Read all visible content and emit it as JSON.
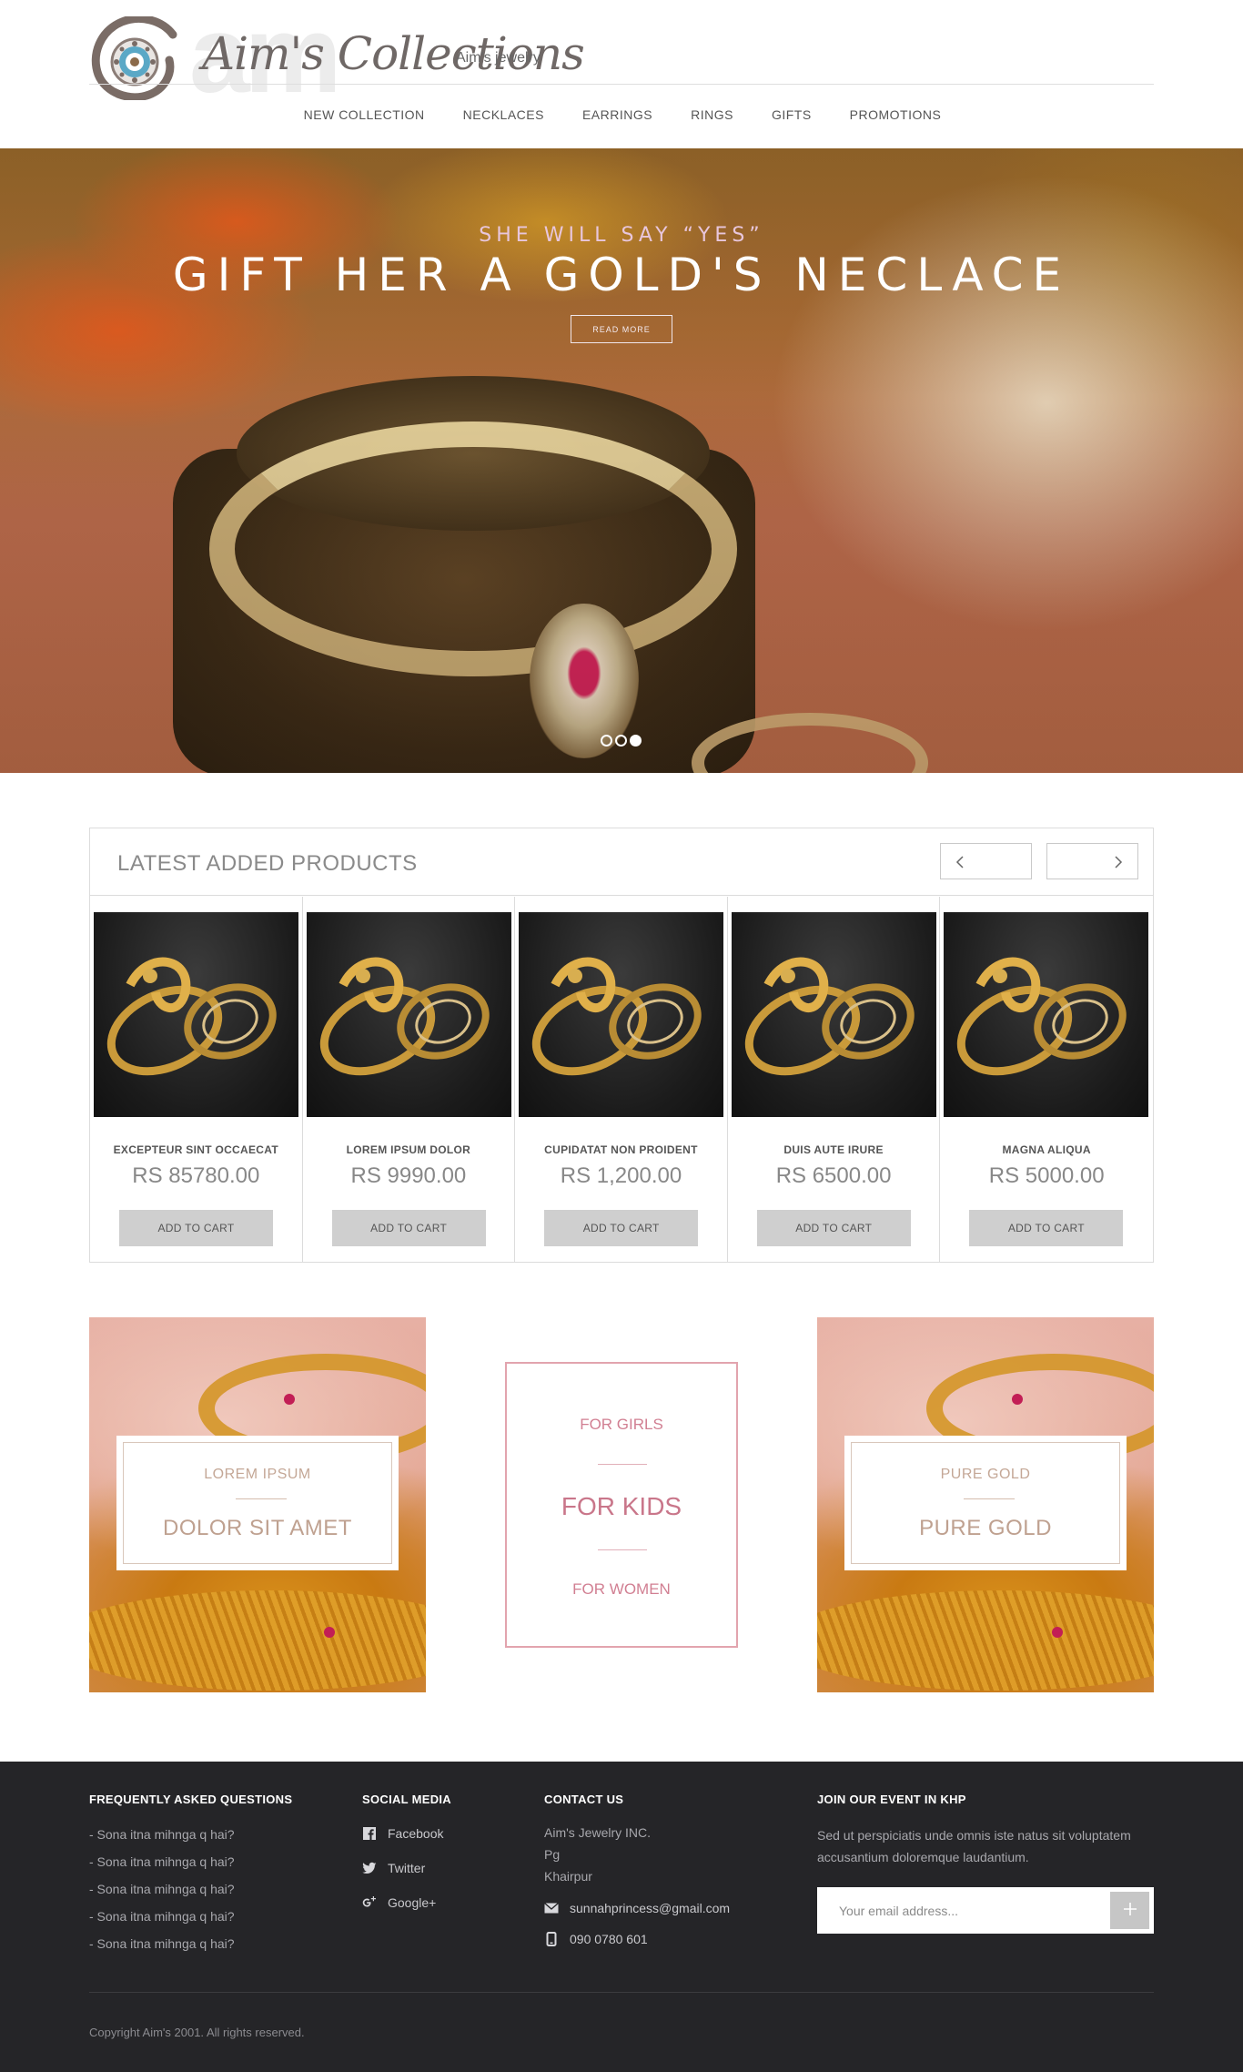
{
  "brand": {
    "ghost_mark": "am",
    "logo_text": "Aim's Collections",
    "tagline": "Aim's jewelry",
    "accent": "#c9768a"
  },
  "nav": {
    "items": [
      "NEW COLLECTION",
      "NECKLACES",
      "EARRINGS",
      "RINGS",
      "GIFTS",
      "PROMOTIONS"
    ]
  },
  "hero": {
    "subtitle": "SHE WILL SAY “YES”",
    "title": "GIFT HER A GOLD'S NECLACE",
    "button": "READ MORE",
    "slides": 3,
    "active_slide": 3
  },
  "latest": {
    "title": "LATEST ADDED PRODUCTS",
    "prev_icon": "chevron-left-icon",
    "next_icon": "chevron-right-icon",
    "products": [
      {
        "name": "EXCEPTEUR SINT OCCAECAT",
        "price": "RS 85780.00",
        "cta": "ADD TO CART"
      },
      {
        "name": "LOREM IPSUM DOLOR",
        "price": "RS 9990.00",
        "cta": "ADD TO CART"
      },
      {
        "name": "CUPIDATAT NON PROIDENT",
        "price": "RS 1,200.00",
        "cta": "ADD TO CART"
      },
      {
        "name": "DUIS AUTE IRURE",
        "price": "RS 6500.00",
        "cta": "ADD TO CART"
      },
      {
        "name": "MAGNA ALIQUA",
        "price": "RS 5000.00",
        "cta": "ADD TO CART"
      }
    ]
  },
  "promos": {
    "left": {
      "line1": "LOREM IPSUM",
      "line2": "DOLOR SIT AMET"
    },
    "center": {
      "top": "FOR GIRLS",
      "middle": "FOR KIDS",
      "bottom": "FOR WOMEN"
    },
    "right": {
      "line1": "PURE GOLD",
      "line2": "PURE GOLD"
    }
  },
  "footer": {
    "faq": {
      "title": "FREQUENTLY ASKED QUESTIONS",
      "items": [
        "- Sona itna mihnga q hai?",
        "- Sona itna mihnga q hai?",
        "- Sona itna mihnga q hai?",
        "- Sona itna mihnga q hai?",
        "- Sona itna mihnga q hai?"
      ]
    },
    "social": {
      "title": "SOCIAL MEDIA",
      "items": [
        {
          "label": "Facebook",
          "icon": "facebook-icon"
        },
        {
          "label": "Twitter",
          "icon": "twitter-icon"
        },
        {
          "label": "Google+",
          "icon": "google-plus-icon"
        }
      ]
    },
    "contact": {
      "title": "CONTACT US",
      "address": [
        "Aim's Jewelry INC.",
        "Pg",
        "Khairpur"
      ],
      "email": "sunnahprincess@gmail.com",
      "phone": "090 0780 601"
    },
    "event": {
      "title": "JOIN OUR EVENT IN KHP",
      "text": "Sed ut perspiciatis unde omnis iste natus sit voluptatem accusantium doloremque laudantium.",
      "placeholder": "Your email address..."
    },
    "copyright": "Copyright Aim's 2001. All rights reserved."
  }
}
